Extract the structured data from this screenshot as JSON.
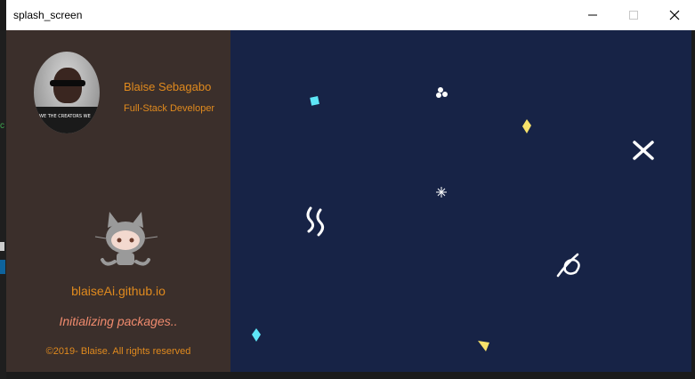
{
  "window": {
    "title": "splash_screen"
  },
  "profile": {
    "name": "Blaise Sebagabo",
    "role": "Full-Stack Developer",
    "shirt_text": "WE THE CREATORS WE"
  },
  "site": "blaiseAi.github.io",
  "status": "Initializing packages..",
  "copyright": "©2019- Blaise. All rights reserved",
  "colors": {
    "sidebar_bg": "#3b2f2b",
    "canvas_bg": "#172346",
    "accent_orange": "#e08a1e",
    "status_salmon": "#f08b6e",
    "confetti_cyan": "#5ee6f7",
    "confetti_yellow": "#f7e26b",
    "confetti_white": "#ffffff"
  },
  "icons": {
    "minimize": "minimize-icon",
    "maximize": "maximize-icon",
    "close": "close-icon",
    "octocat": "octocat-icon"
  }
}
